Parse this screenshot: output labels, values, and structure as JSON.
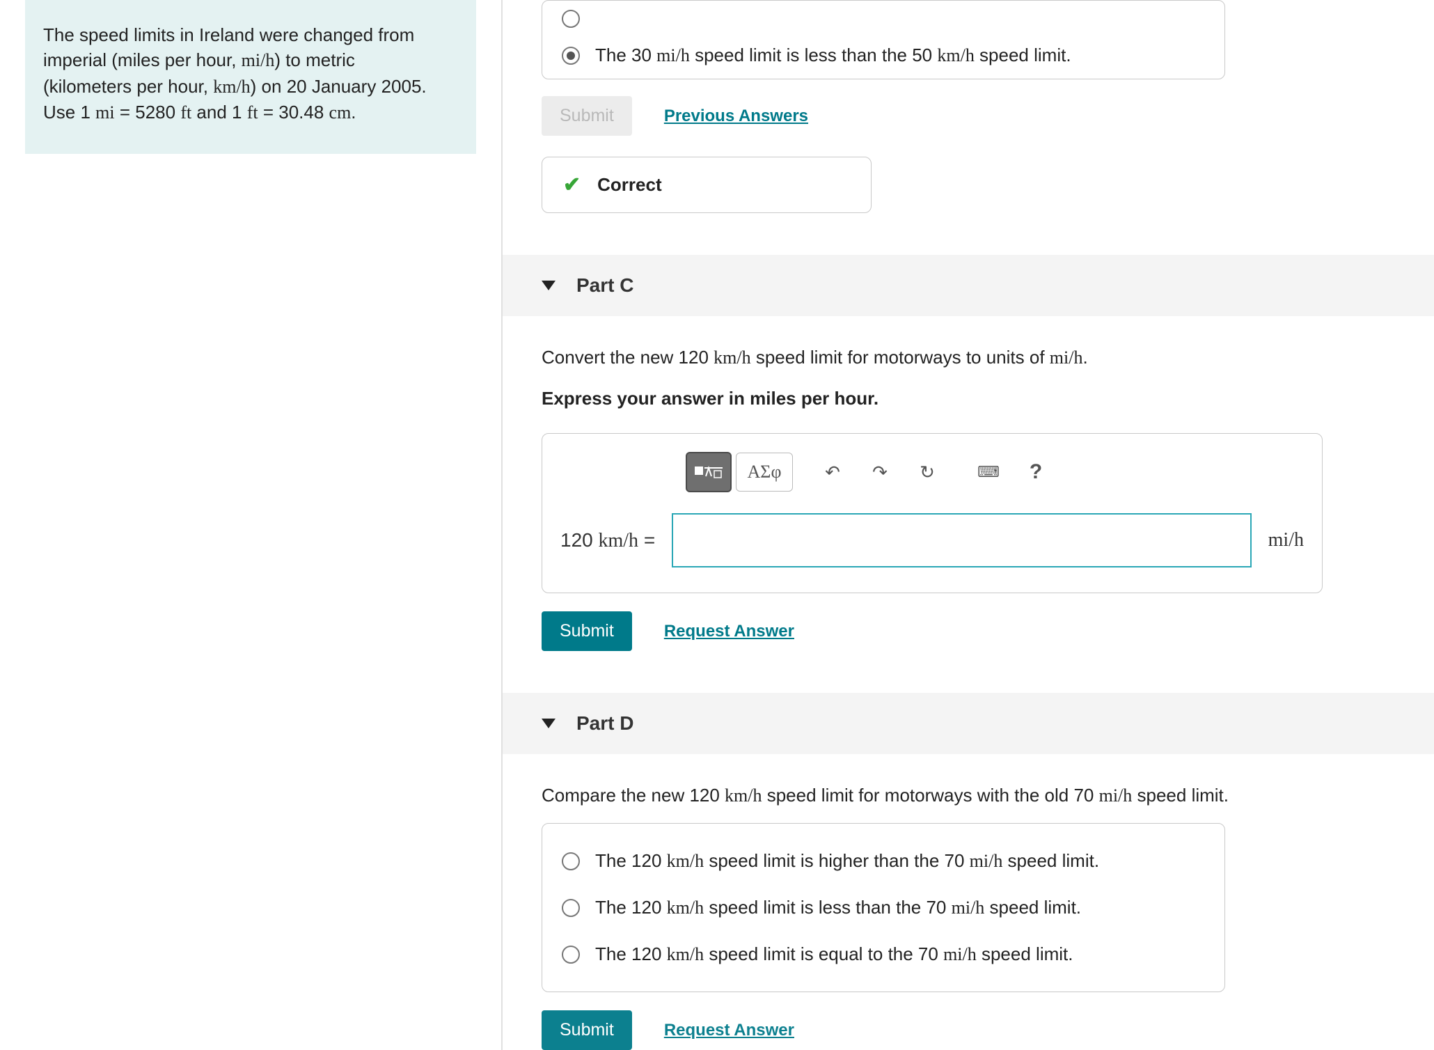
{
  "info": {
    "text_pre": "The speed limits in Ireland were changed from imperial (miles per hour, ",
    "unit1": "mi/h",
    "text_mid1": ") to metric (kilometers per hour, ",
    "unit2": "km/h",
    "text_mid2": ") on 20 January 2005. Use 1 ",
    "unit3": "mi",
    "text_mid3": " = 5280 ",
    "unit4": "ft",
    "text_mid4": " and 1 ",
    "unit5": "ft",
    "text_mid5": " = 30.48 ",
    "unit6": "cm",
    "text_end": "."
  },
  "partB": {
    "option_top_pre": "",
    "option_sel_pre": "The 30 ",
    "option_sel_u1": "mi/h",
    "option_sel_mid": " speed limit is less than the 50 ",
    "option_sel_u2": "km/h",
    "option_sel_end": " speed limit.",
    "submit": "Submit",
    "prev": "Previous Answers",
    "correct": "Correct"
  },
  "partC": {
    "title": "Part C",
    "prompt_pre": "Convert the new 120 ",
    "prompt_u1": "km/h",
    "prompt_mid": " speed limit for motorways to units of ",
    "prompt_u2": "mi/h",
    "prompt_end": ".",
    "instruction": "Express your answer in miles per hour.",
    "lhs_pre": "120 ",
    "lhs_u": "km/h",
    "lhs_eq": " =",
    "rhs": "mi/h",
    "toolbar": {
      "templates": "■√☐",
      "greek": "ΑΣφ",
      "undo": "↶",
      "redo": "↷",
      "reset": "↻",
      "keyboard": "⌨",
      "help": "?"
    },
    "submit": "Submit",
    "request": "Request Answer"
  },
  "partD": {
    "title": "Part D",
    "prompt_pre": "Compare the new 120 ",
    "prompt_u1": "km/h",
    "prompt_mid": " speed limit for motorways with the old 70 ",
    "prompt_u2": "mi/h",
    "prompt_end": " speed limit.",
    "opts": [
      {
        "pre": "The 120 ",
        "u1": "km/h",
        "mid": " speed limit is higher than the 70 ",
        "u2": "mi/h",
        "end": " speed limit."
      },
      {
        "pre": "The 120 ",
        "u1": "km/h",
        "mid": " speed limit is less than the 70 ",
        "u2": "mi/h",
        "end": " speed limit."
      },
      {
        "pre": "The 120 ",
        "u1": "km/h",
        "mid": " speed limit is equal to the 70 ",
        "u2": "mi/h",
        "end": " speed limit."
      }
    ],
    "submit": "Submit",
    "request": "Request Answer"
  }
}
